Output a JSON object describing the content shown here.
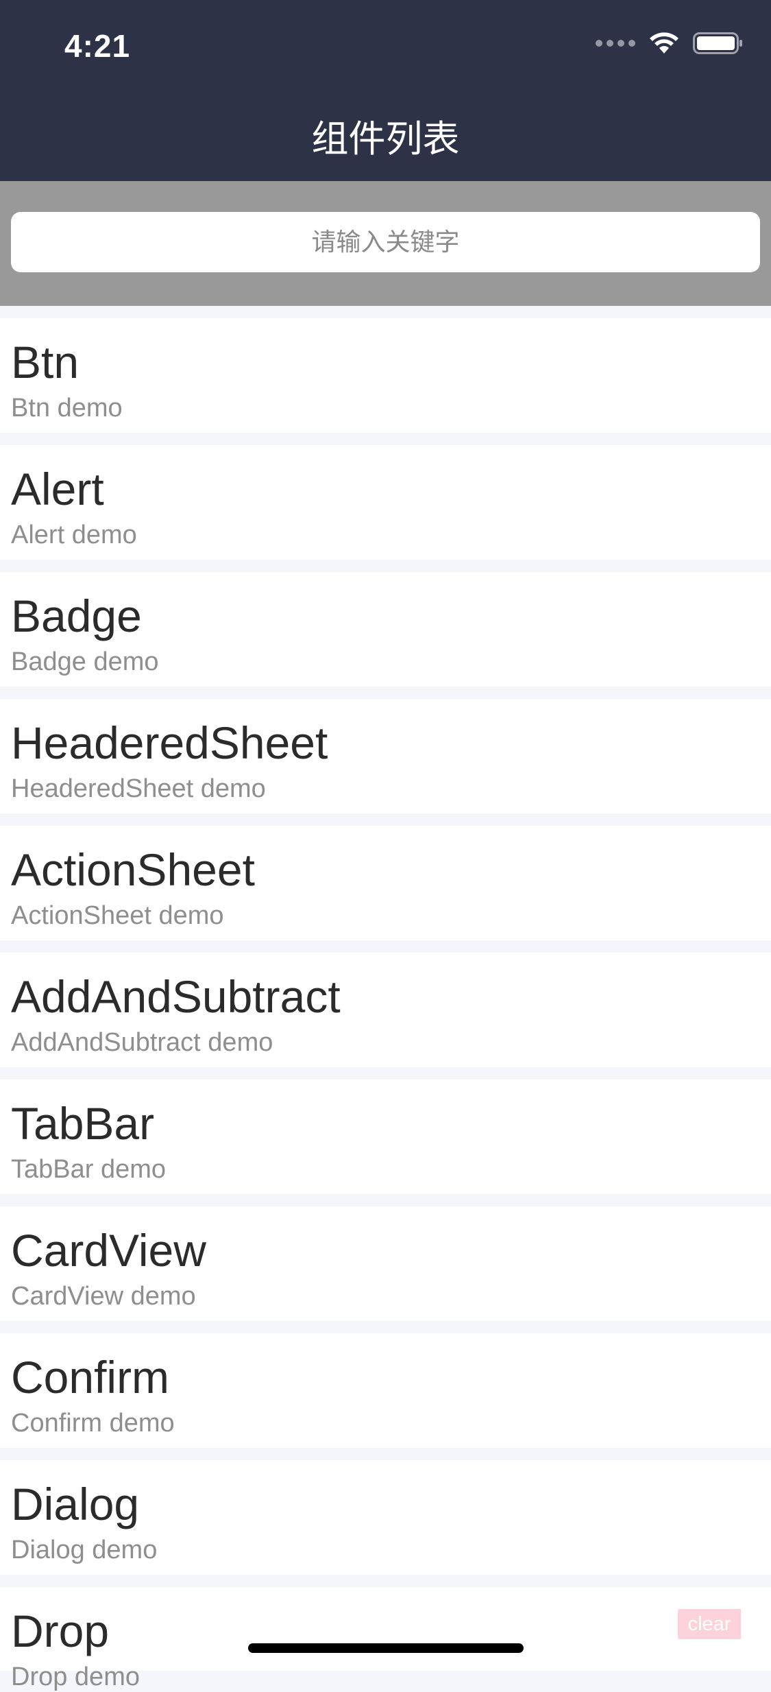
{
  "status_bar": {
    "time": "4:21",
    "icons": [
      "signal-dots-icon",
      "wifi-icon",
      "battery-icon"
    ]
  },
  "nav": {
    "title": "组件列表"
  },
  "search": {
    "placeholder": "请输入关键字",
    "value": ""
  },
  "items": [
    {
      "title": "Btn",
      "subtitle": "Btn demo"
    },
    {
      "title": "Alert",
      "subtitle": "Alert demo"
    },
    {
      "title": "Badge",
      "subtitle": "Badge demo"
    },
    {
      "title": "HeaderedSheet",
      "subtitle": "HeaderedSheet demo"
    },
    {
      "title": "ActionSheet",
      "subtitle": "ActionSheet demo"
    },
    {
      "title": "AddAndSubtract",
      "subtitle": "AddAndSubtract demo"
    },
    {
      "title": "TabBar",
      "subtitle": "TabBar demo"
    },
    {
      "title": "CardView",
      "subtitle": "CardView demo"
    },
    {
      "title": "Confirm",
      "subtitle": "Confirm demo"
    },
    {
      "title": "Dialog",
      "subtitle": "Dialog demo"
    },
    {
      "title": "Drop",
      "subtitle": "Drop demo"
    }
  ],
  "floating": {
    "clear_label": "clear"
  },
  "colors": {
    "header_bg": "#2d3247",
    "search_area_bg": "#999999",
    "list_separator": "#f5f6fb",
    "clear_bg": "#fdd2da"
  }
}
